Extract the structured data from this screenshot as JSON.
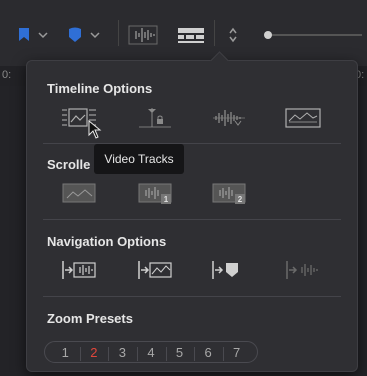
{
  "toolbar": {
    "icons": [
      "flag-icon",
      "chevron-down-icon",
      "marker-icon",
      "chevron-down-icon",
      "audio-waveform-icon",
      "timeline-view-options-icon",
      "up-down-arrows-icon",
      "zoom-slider"
    ]
  },
  "ruler": {
    "left_label": "0:",
    "right_label": "0:"
  },
  "panel": {
    "timeline_options": {
      "title": "Timeline Options",
      "icons": [
        "filmstrip-thumbnail-icon",
        "track-lock-icon",
        "audio-waveform-icon",
        "waveform-thumbnail-icon"
      ]
    },
    "scroller": {
      "title": "Scrolle",
      "icons": [
        "video-thumbnail-icon",
        "audio-track-1-icon",
        "audio-track-2-icon"
      ]
    },
    "navigation_options": {
      "title": "Navigation Options",
      "icons": [
        "scroll-to-audio-icon",
        "scroll-to-video-icon",
        "scroll-to-marker-icon",
        "scroll-to-waveform-icon"
      ]
    },
    "zoom_presets": {
      "title": "Zoom Presets",
      "presets": [
        "1",
        "2",
        "3",
        "4",
        "5",
        "6",
        "7"
      ],
      "active_index": 1
    }
  },
  "tooltip": {
    "text": "Video Tracks"
  },
  "colors": {
    "accent_blue": "#2f6fd6",
    "active_red": "#e1463b"
  }
}
